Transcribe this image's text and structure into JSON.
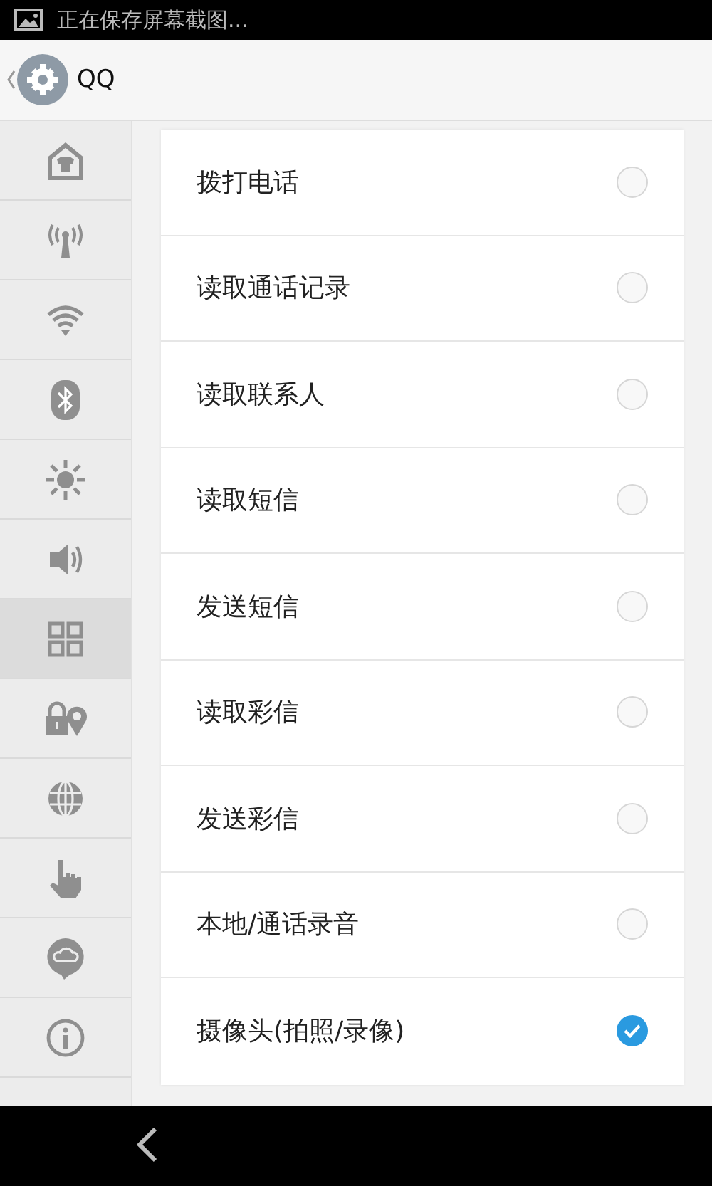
{
  "status_bar": {
    "notification": "正在保存屏幕截图..."
  },
  "header": {
    "title": "QQ"
  },
  "sidebar": {
    "items": [
      {
        "kind": "home",
        "selected": false
      },
      {
        "kind": "signal",
        "selected": false
      },
      {
        "kind": "wifi",
        "selected": false
      },
      {
        "kind": "bluetooth",
        "selected": false
      },
      {
        "kind": "brightness",
        "selected": false
      },
      {
        "kind": "sound",
        "selected": false
      },
      {
        "kind": "apps",
        "selected": true
      },
      {
        "kind": "lock-location",
        "selected": false
      },
      {
        "kind": "globe",
        "selected": false
      },
      {
        "kind": "touch",
        "selected": false
      },
      {
        "kind": "cloud",
        "selected": false
      },
      {
        "kind": "info",
        "selected": false
      }
    ]
  },
  "permissions": [
    {
      "label": "拨打电话",
      "checked": false
    },
    {
      "label": "读取通话记录",
      "checked": false
    },
    {
      "label": "读取联系人",
      "checked": false
    },
    {
      "label": "读取短信",
      "checked": false
    },
    {
      "label": "发送短信",
      "checked": false
    },
    {
      "label": "读取彩信",
      "checked": false
    },
    {
      "label": "发送彩信",
      "checked": false
    },
    {
      "label": "本地/通话录音",
      "checked": false
    },
    {
      "label": "摄像头(拍照/录像)",
      "checked": true
    }
  ]
}
